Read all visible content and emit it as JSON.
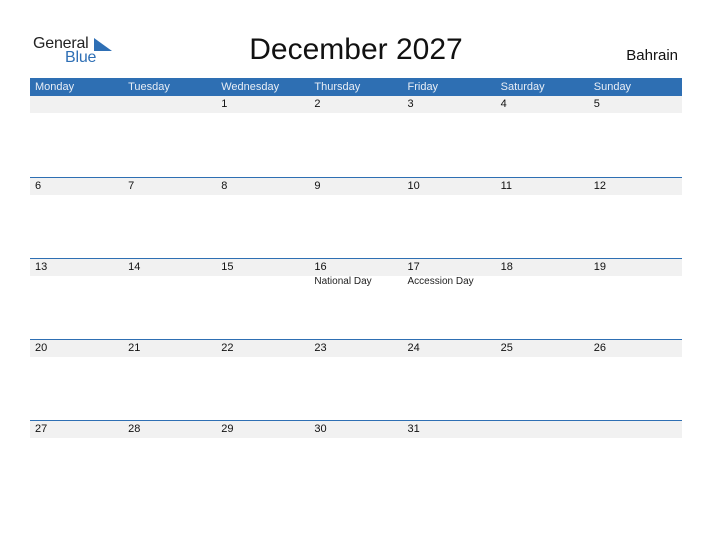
{
  "logo": {
    "line1": "General",
    "line2": "Blue"
  },
  "title": "December 2027",
  "country": "Bahrain",
  "colors": {
    "accent": "#2e6fb3",
    "date_band": "#f1f1f1"
  },
  "weekdays": [
    "Monday",
    "Tuesday",
    "Wednesday",
    "Thursday",
    "Friday",
    "Saturday",
    "Sunday"
  ],
  "weeks": [
    {
      "days": [
        "",
        "",
        "1",
        "2",
        "3",
        "4",
        "5"
      ],
      "holidays": [
        "",
        "",
        "",
        "",
        "",
        "",
        ""
      ]
    },
    {
      "days": [
        "6",
        "7",
        "8",
        "9",
        "10",
        "11",
        "12"
      ],
      "holidays": [
        "",
        "",
        "",
        "",
        "",
        "",
        ""
      ]
    },
    {
      "days": [
        "13",
        "14",
        "15",
        "16",
        "17",
        "18",
        "19"
      ],
      "holidays": [
        "",
        "",
        "",
        "National Day",
        "Accession Day",
        "",
        ""
      ]
    },
    {
      "days": [
        "20",
        "21",
        "22",
        "23",
        "24",
        "25",
        "26"
      ],
      "holidays": [
        "",
        "",
        "",
        "",
        "",
        "",
        ""
      ]
    },
    {
      "days": [
        "27",
        "28",
        "29",
        "30",
        "31",
        "",
        ""
      ],
      "holidays": [
        "",
        "",
        "",
        "",
        "",
        "",
        ""
      ]
    }
  ]
}
